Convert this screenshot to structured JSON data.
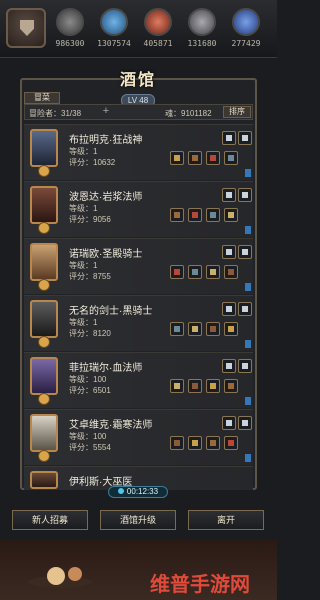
{
  "resources": [
    {
      "value": "986300",
      "color": "#6a6a6a"
    },
    {
      "value": "1307574",
      "color": "#3f7fb8"
    },
    {
      "value": "405871",
      "color": "#b04a3a"
    },
    {
      "value": "131680",
      "color": "#7a7a80"
    },
    {
      "value": "277429",
      "color": "#4a6aa8"
    }
  ],
  "panel": {
    "title": "酒馆",
    "level": "LV 48",
    "adventurer_tab": "冒菜",
    "adventurers": "冒险者：31/38",
    "soul": "魂：9101182",
    "sort": "排序"
  },
  "heroes": [
    {
      "name": "布拉明克·狂战神",
      "level": "等级：1",
      "score": "评分：10632",
      "frame": "#c68a3f"
    },
    {
      "name": "波恩达·岩浆法师",
      "level": "等级：1",
      "score": "评分：9056",
      "frame": "#c68a3f"
    },
    {
      "name": "诺瑞欧·圣殿骑士",
      "level": "等级：1",
      "score": "评分：8755",
      "frame": "#c68a3f"
    },
    {
      "name": "无名的剑士·黑骑士",
      "level": "等级：1",
      "score": "评分：8120",
      "frame": "#c68a3f"
    },
    {
      "name": "菲拉瑞尔·血法师",
      "level": "等级：100",
      "score": "评分：6501",
      "frame": "#c68a3f"
    },
    {
      "name": "艾卓维克·霜寒法师",
      "level": "等级：100",
      "score": "评分：5554",
      "frame": "#c68a3f"
    },
    {
      "name": "伊利斯·大巫医",
      "level": "",
      "score": "",
      "frame": "#c68a3f"
    }
  ],
  "timer": "00:12:33",
  "buttons": {
    "recruit": "新人招募",
    "upgrade": "酒馆升级",
    "leave": "离开"
  },
  "watermark": "维普手游网"
}
